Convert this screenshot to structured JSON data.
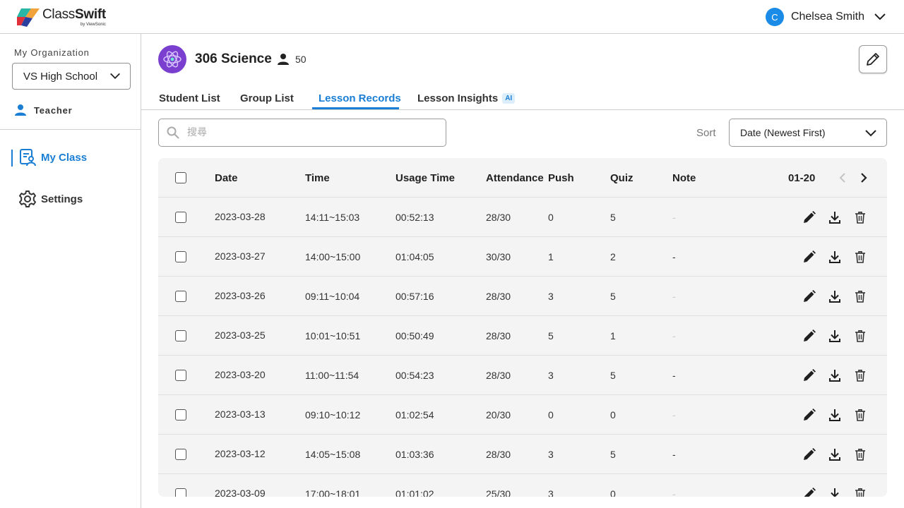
{
  "app": {
    "logo_word_light": "Class",
    "logo_word_bold": "Swift",
    "logo_sub": "by ViewSonic"
  },
  "user": {
    "initial": "C",
    "name": "Chelsea Smith"
  },
  "sidebar": {
    "org_label": "My Organization",
    "org_value": "VS High School",
    "role": "Teacher",
    "nav": [
      {
        "label": "My Class",
        "icon": "class-roster-icon",
        "active": true
      },
      {
        "label": "Settings",
        "icon": "gear-icon",
        "active": false
      }
    ]
  },
  "class": {
    "title": "306 Science",
    "student_count": "50"
  },
  "tabs": [
    {
      "label": "Student List"
    },
    {
      "label": "Group List"
    },
    {
      "label": "Lesson Records",
      "active": true
    },
    {
      "label": "Lesson Insights",
      "badge": "AI"
    }
  ],
  "search": {
    "placeholder": "搜尋"
  },
  "sort": {
    "label": "Sort",
    "value": "Date (Newest First)"
  },
  "table": {
    "headers": {
      "date": "Date",
      "time": "Time",
      "usage": "Usage Time",
      "attendance": "Attendance",
      "push": "Push",
      "quiz": "Quiz",
      "note": "Note"
    },
    "page_range": "01-20",
    "rows": [
      {
        "date": "2023-03-28",
        "time": "14:11~15:03",
        "usage": "00:52:13",
        "attendance": "28/30",
        "push": "0",
        "quiz": "5",
        "note": "-",
        "note_muted": true
      },
      {
        "date": "2023-03-27",
        "time": "14:00~15:00",
        "usage": "01:04:05",
        "attendance": "30/30",
        "push": "1",
        "quiz": "2",
        "note": "-",
        "note_muted": false
      },
      {
        "date": "2023-03-26",
        "time": "09:11~10:04",
        "usage": "00:57:16",
        "attendance": "28/30",
        "push": "3",
        "quiz": "5",
        "note": "-",
        "note_muted": true
      },
      {
        "date": "2023-03-25",
        "time": "10:01~10:51",
        "usage": "00:50:49",
        "attendance": "28/30",
        "push": "5",
        "quiz": "1",
        "note": "-",
        "note_muted": true
      },
      {
        "date": "2023-03-20",
        "time": "11:00~11:54",
        "usage": "00:54:23",
        "attendance": "28/30",
        "push": "3",
        "quiz": "5",
        "note": "-",
        "note_muted": false
      },
      {
        "date": "2023-03-13",
        "time": "09:10~10:12",
        "usage": "01:02:54",
        "attendance": "20/30",
        "push": "0",
        "quiz": "0",
        "note": "-",
        "note_muted": true
      },
      {
        "date": "2023-03-12",
        "time": "14:05~15:08",
        "usage": "01:03:36",
        "attendance": "28/30",
        "push": "3",
        "quiz": "5",
        "note": "-",
        "note_muted": false
      },
      {
        "date": "2023-03-09",
        "time": "17:00~18:01",
        "usage": "01:01:02",
        "attendance": "25/30",
        "push": "3",
        "quiz": "0",
        "note": "-",
        "note_muted": true
      }
    ]
  },
  "colors": {
    "accent": "#1a7fd4",
    "avatar": "#1a8be6",
    "class_avatar": "#7b3fd0",
    "table_bg": "#f4f4f4"
  }
}
